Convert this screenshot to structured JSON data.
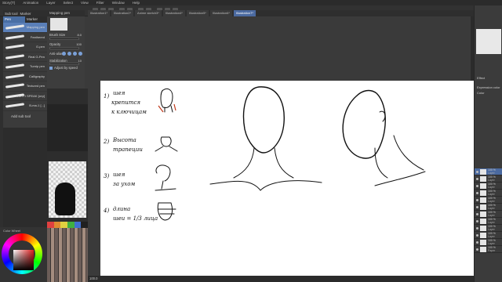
{
  "menu": [
    "Story(T)",
    "Animation",
    "Layer",
    "Select",
    "View",
    "Filter",
    "Window",
    "Help"
  ],
  "subtool": {
    "tabs": [
      "Sub tool",
      "Marker"
    ],
    "pen_tabs": [
      "Pen",
      "Marker"
    ],
    "brushes": [
      {
        "label": "Mapping pen"
      },
      {
        "label": "Feathered"
      },
      {
        "label": "G-pen"
      },
      {
        "label": "Real G-Pen"
      },
      {
        "label": "Turnip pen"
      },
      {
        "label": "Calligraphy"
      },
      {
        "label": "Textured pen"
      },
      {
        "label": "YOTTI SPEAK [отр]"
      },
      {
        "label": "B-ma-1 [...]"
      }
    ],
    "add_label": "Add sub tool"
  },
  "tool_property": {
    "tab": "Mapping pen",
    "rows": [
      {
        "label": "Brush Size",
        "value": "8.0"
      },
      {
        "label": "Opacity",
        "value": "100"
      },
      {
        "label": "Anti-alias",
        "value": ""
      },
      {
        "label": "Stabilization",
        "value": "10"
      },
      {
        "label": "Adjust by speed",
        "value": ""
      }
    ]
  },
  "canvas_tabs": [
    "Illustration1*",
    "Illustration2*",
    "Anime sketch3*",
    "Illustration4*",
    "Illustration5*",
    "Illustration6*",
    "Illustration7*"
  ],
  "status": {
    "zoom": "100.0"
  },
  "color_wheel": {
    "title": "Color Wheel",
    "hue": "#e02020"
  },
  "right_panel": {
    "sublabel_1": "Effect",
    "sublabel_2": "Expression color",
    "sublabel_3": "Color",
    "layers": [
      {
        "pct": "100 %",
        "name": "Layer"
      },
      {
        "pct": "100 %",
        "name": "Layer"
      },
      {
        "pct": "100 %",
        "name": "Layer"
      },
      {
        "pct": "100 %",
        "name": "Layer"
      },
      {
        "pct": "100 %",
        "name": "Layer"
      },
      {
        "pct": "100 %",
        "name": "Layer"
      },
      {
        "pct": "100 %",
        "name": "Layer"
      },
      {
        "pct": "100 %",
        "name": "Layer"
      },
      {
        "pct": "100 %",
        "name": "Layer"
      },
      {
        "pct": "100 %",
        "name": "Layer"
      },
      {
        "pct": "100 %",
        "name": "Layer"
      },
      {
        "pct": "100 %",
        "name": "Paper"
      }
    ]
  },
  "notes": {
    "n1": "1)",
    "t1a": "шея",
    "t1b": "крепится",
    "t1c": "к ключицам",
    "n2": "2)",
    "t2a": "Высота",
    "t2b": "трапеции",
    "n3": "3)",
    "t3a": "шея",
    "t3b": "за ухом",
    "n4": "4)",
    "t4a": "длина",
    "t4b": "шеи = 1/3 лица"
  }
}
